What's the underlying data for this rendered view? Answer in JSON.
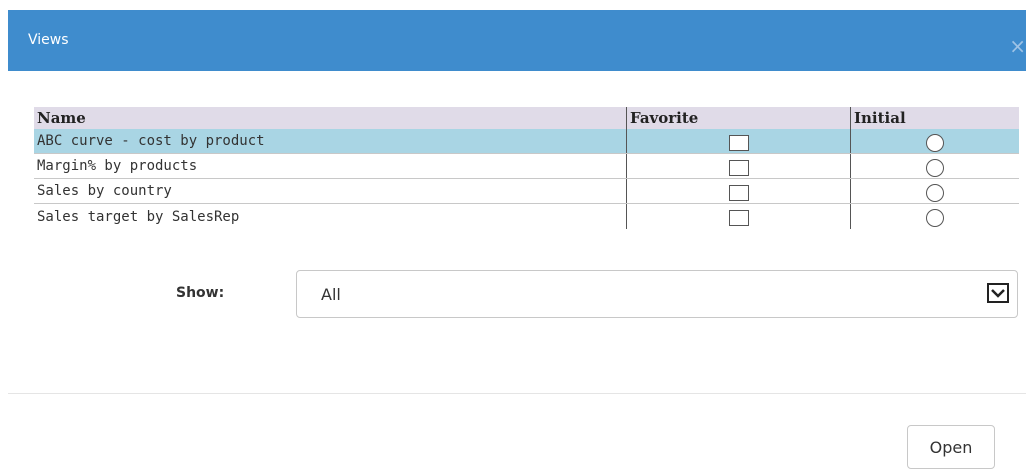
{
  "dialog": {
    "title": "Views",
    "close_icon": "×"
  },
  "table": {
    "columns": [
      "Name",
      "Favorite",
      "Initial"
    ],
    "rows": [
      {
        "name": "ABC curve - cost by product",
        "favorite": false,
        "initial": false,
        "selected": true
      },
      {
        "name": "Margin% by products",
        "favorite": false,
        "initial": false,
        "selected": false
      },
      {
        "name": "Sales by country",
        "favorite": false,
        "initial": false,
        "selected": false
      },
      {
        "name": "Sales target by SalesRep",
        "favorite": false,
        "initial": false,
        "selected": false
      }
    ]
  },
  "show": {
    "label": "Show:",
    "value": "All"
  },
  "buttons": {
    "open": "Open"
  },
  "colors": {
    "titlebar": "#3f8ccd",
    "header_bg": "#e0dbe8",
    "selected_row": "#a9d5e4"
  }
}
